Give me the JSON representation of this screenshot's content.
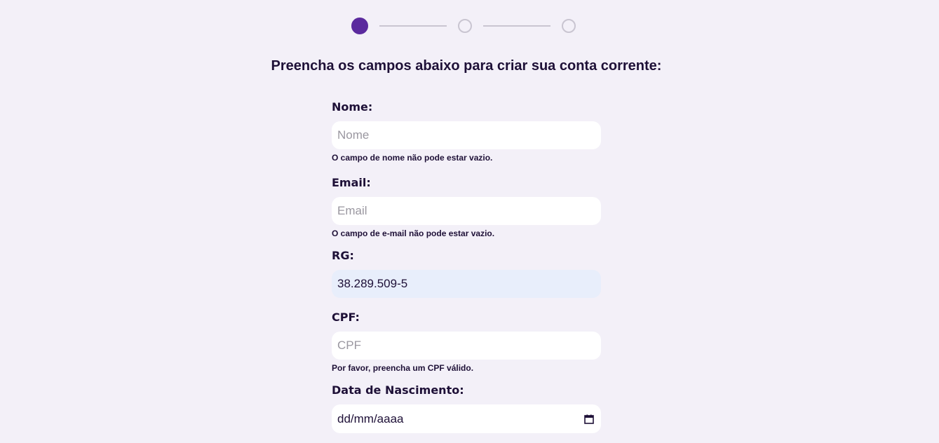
{
  "stepper": {
    "steps": [
      {
        "label": "step-1",
        "active": true
      },
      {
        "label": "step-2",
        "active": false
      },
      {
        "label": "step-3",
        "active": false
      }
    ],
    "active_color": "#5b2a9e"
  },
  "page": {
    "title": "Preencha os campos abaixo para criar sua conta corrente:"
  },
  "form": {
    "nome": {
      "label": "Nome:",
      "placeholder": "Nome",
      "value": "",
      "error": "O campo de nome não pode estar vazio."
    },
    "email": {
      "label": "Email:",
      "placeholder": "Email",
      "value": "",
      "error": "O campo de e-mail não pode estar vazio."
    },
    "rg": {
      "label": "RG:",
      "value": "38.289.509-5"
    },
    "cpf": {
      "label": "CPF:",
      "placeholder": "CPF",
      "value": "",
      "error": "Por favor, preencha um CPF válido."
    },
    "nascimento": {
      "label": "Data de Nascimento:",
      "value": "dd/mm/aaaa",
      "icon": "calendar-icon"
    }
  }
}
